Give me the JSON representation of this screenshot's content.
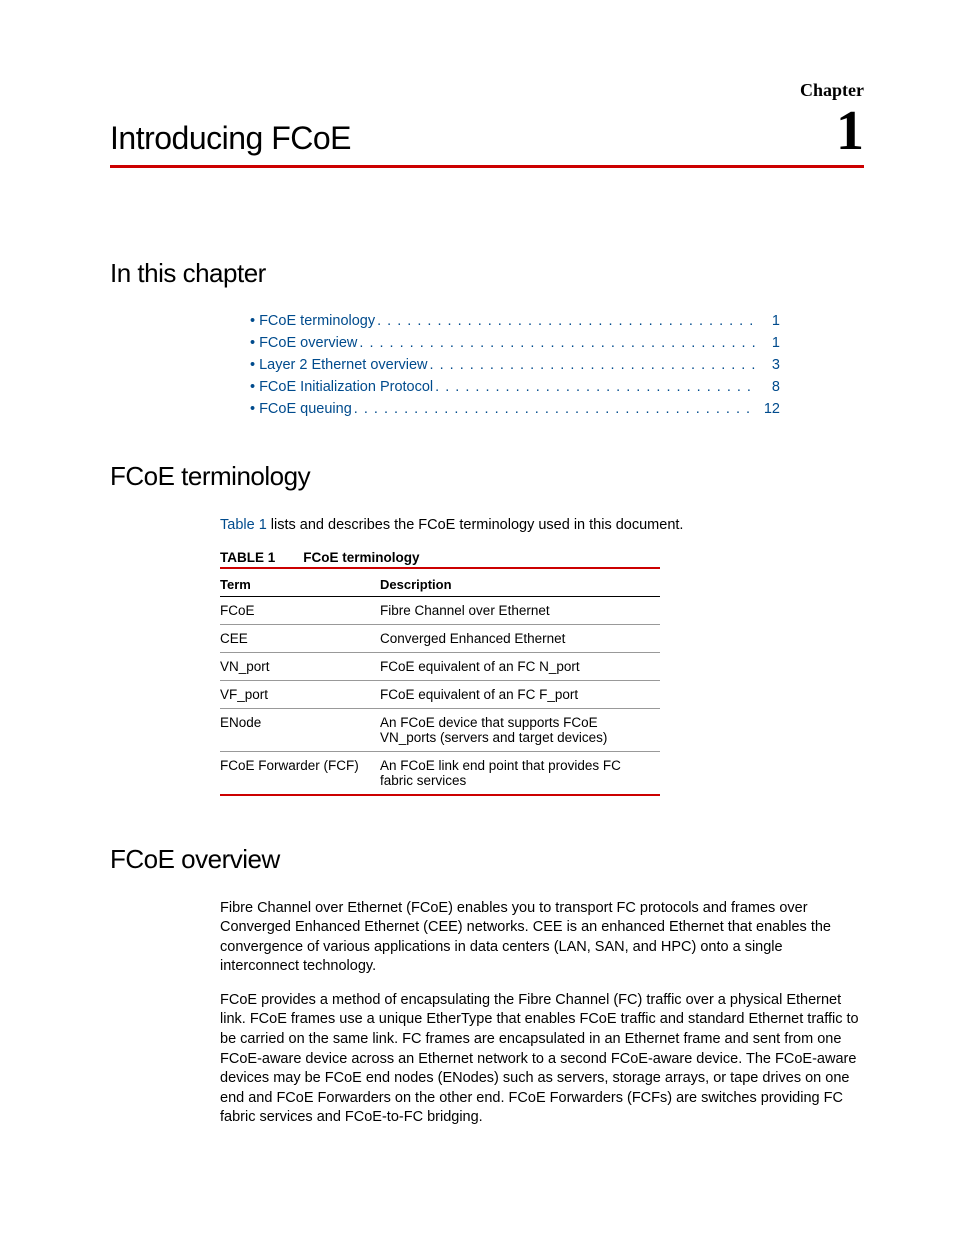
{
  "chapter": {
    "label": "Chapter",
    "number": "1",
    "title": "Introducing FCoE"
  },
  "sections": {
    "in_this_chapter": "In this chapter",
    "fcoe_terminology": "FCoE terminology",
    "fcoe_overview": "FCoE overview"
  },
  "toc": [
    {
      "label": "FCoE terminology",
      "page": "1"
    },
    {
      "label": "FCoE overview",
      "page": "1"
    },
    {
      "label": "Layer 2 Ethernet overview",
      "page": "3"
    },
    {
      "label": "FCoE Initialization Protocol",
      "page": "8"
    },
    {
      "label": "FCoE queuing",
      "page": "12"
    }
  ],
  "terminology_intro": {
    "link": "Table 1",
    "rest": " lists and describes the FCoE terminology used in this document."
  },
  "table": {
    "label": "TABLE 1",
    "caption": "FCoE terminology",
    "headers": {
      "term": "Term",
      "description": "Description"
    },
    "rows": [
      {
        "term": "FCoE",
        "description": "Fibre Channel over Ethernet"
      },
      {
        "term": "CEE",
        "description": "Converged Enhanced Ethernet"
      },
      {
        "term": "VN_port",
        "description": "FCoE equivalent of an FC N_port"
      },
      {
        "term": "VF_port",
        "description": "FCoE equivalent of an FC F_port"
      },
      {
        "term": "ENode",
        "description": "An FCoE device that supports FCoE VN_ports (servers and target devices)"
      },
      {
        "term": "FCoE Forwarder (FCF)",
        "description": "An FCoE link end point that provides FC fabric services"
      }
    ]
  },
  "overview": {
    "p1": "Fibre Channel over Ethernet (FCoE) enables you to transport FC protocols and frames over Converged Enhanced Ethernet (CEE) networks. CEE is an enhanced Ethernet that enables the convergence of various applications in data centers (LAN, SAN, and HPC) onto a single interconnect technology.",
    "p2": "FCoE provides a method of encapsulating the Fibre Channel (FC) traffic over a physical Ethernet link. FCoE frames use a unique EtherType that enables FCoE traffic and standard Ethernet traffic to be carried on the same link. FC frames are encapsulated in an Ethernet frame and sent from one FCoE-aware device across an Ethernet network to a second FCoE-aware device. The FCoE-aware devices may be FCoE end nodes (ENodes) such as servers, storage arrays, or tape drives on one end and FCoE Forwarders on the other end. FCoE Forwarders (FCFs) are switches providing FC fabric services and FCoE-to-FC bridging."
  }
}
